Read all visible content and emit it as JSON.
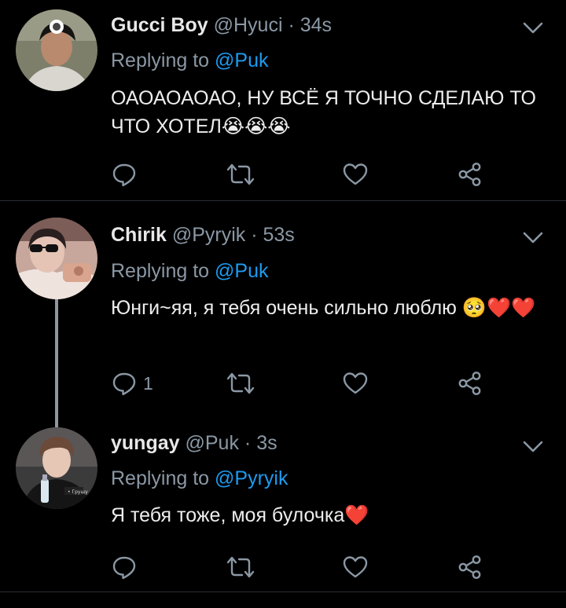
{
  "tweets": [
    {
      "name": "Gucci Boy",
      "handle": "@Hyuci",
      "dot": "·",
      "time": "34s",
      "replying_label": "Replying to",
      "replying_to": "@Puk",
      "text": "ОАОАОАОАО, НУ ВСЁ Я ТОЧНО СДЕЛАЮ ТО ЧТО ХОТЕЛ",
      "text_emoji": "😭😭😭",
      "reply_count": ""
    },
    {
      "name": "Chirik",
      "handle": "@Pyryik",
      "dot": "·",
      "time": "53s",
      "replying_label": "Replying to",
      "replying_to": "@Puk",
      "text": "Юнги~яя, я тебя очень сильно люблю",
      "text_emoji": "🥺❤️❤️",
      "reply_count": "1"
    },
    {
      "name": "yungay",
      "handle": "@Puk",
      "dot": "·",
      "time": "3s",
      "replying_label": "Replying to",
      "replying_to": "@Pyryik",
      "text": "Я тебя тоже, моя булочка",
      "text_emoji": "❤️",
      "reply_count": ""
    }
  ],
  "icons": {
    "reply": "reply-icon",
    "retweet": "retweet-icon",
    "like": "like-icon",
    "share": "share-icon",
    "more": "chevron-down-icon"
  },
  "colors": {
    "background": "#000000",
    "link": "#1d9bf0",
    "muted": "#8b98a5",
    "icon": "#8b98a5"
  }
}
